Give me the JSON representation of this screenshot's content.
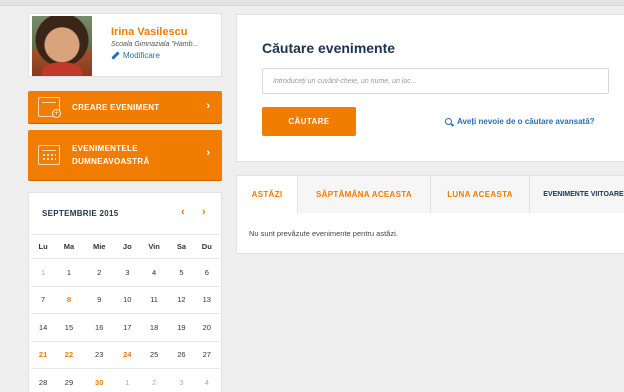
{
  "profile": {
    "name": "Irina Vasilescu",
    "school": "Scoala Gimnaziala \"Hamb...",
    "modify_label": "Modificare"
  },
  "actions": {
    "create_label": "CREARE EVENIMENT",
    "mine_line1": "EVENIMENTELE",
    "mine_line2": "DUMNEAVOASTRĂ",
    "chevron": "›"
  },
  "calendar": {
    "month_label": "SEPTEMBRIE 2015",
    "prev": "‹",
    "next": "›",
    "weekdays": [
      "Lu",
      "Ma",
      "Mie",
      "Jo",
      "Vin",
      "Sa",
      "Du"
    ],
    "weeks": [
      [
        {
          "d": "1",
          "s": "m"
        },
        {
          "d": "1",
          "s": ""
        },
        {
          "d": "2",
          "s": ""
        },
        {
          "d": "3",
          "s": ""
        },
        {
          "d": "4",
          "s": ""
        },
        {
          "d": "5",
          "s": ""
        },
        {
          "d": "6",
          "s": ""
        }
      ],
      [
        {
          "d": "7",
          "s": ""
        },
        {
          "d": "8",
          "s": "o"
        },
        {
          "d": "9",
          "s": ""
        },
        {
          "d": "10",
          "s": ""
        },
        {
          "d": "11",
          "s": ""
        },
        {
          "d": "12",
          "s": ""
        },
        {
          "d": "13",
          "s": ""
        }
      ],
      [
        {
          "d": "14",
          "s": ""
        },
        {
          "d": "15",
          "s": ""
        },
        {
          "d": "16",
          "s": ""
        },
        {
          "d": "17",
          "s": ""
        },
        {
          "d": "18",
          "s": ""
        },
        {
          "d": "19",
          "s": ""
        },
        {
          "d": "20",
          "s": ""
        }
      ],
      [
        {
          "d": "21",
          "s": "o"
        },
        {
          "d": "22",
          "s": "o"
        },
        {
          "d": "23",
          "s": ""
        },
        {
          "d": "24",
          "s": "o"
        },
        {
          "d": "25",
          "s": ""
        },
        {
          "d": "26",
          "s": ""
        },
        {
          "d": "27",
          "s": ""
        }
      ],
      [
        {
          "d": "28",
          "s": ""
        },
        {
          "d": "29",
          "s": ""
        },
        {
          "d": "30",
          "s": "o"
        },
        {
          "d": "1",
          "s": "m"
        },
        {
          "d": "2",
          "s": "m"
        },
        {
          "d": "3",
          "s": "m"
        },
        {
          "d": "4",
          "s": "m"
        }
      ]
    ]
  },
  "search": {
    "title": "Căutare evenimente",
    "placeholder": "Introduceți un cuvânt-cheie, un nume, un loc...",
    "button_label": "CĂUTARE",
    "advanced_label": "Aveți nevoie de o căutare avansată?"
  },
  "events": {
    "tabs": [
      "ASTĂZI",
      "SĂPTĂMÂNA ACEASTA",
      "LUNA ACEASTA",
      "EVENIMENTE VIITOARE"
    ],
    "active_tab": 0,
    "empty_message": "Nu sunt prevăzute evenimente pentru astăzi."
  },
  "colors": {
    "accent": "#f07c00",
    "navy": "#1a3450",
    "link": "#2a6fb0"
  }
}
